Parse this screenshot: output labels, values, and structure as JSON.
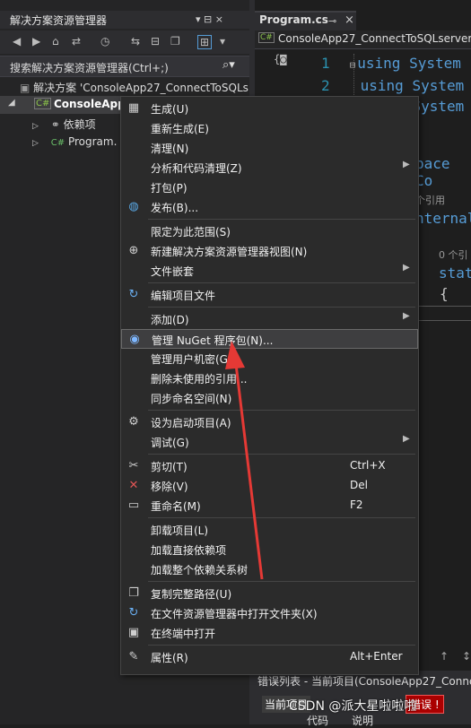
{
  "solution_explorer": {
    "title": "解决方案资源管理器",
    "pin_glyphs": "▾ ⊟ ×",
    "search_placeholder": "搜索解决方案资源管理器(Ctrl+;)",
    "tree": [
      {
        "label": "解决方案 'ConsoleApp27_ConnectToSQLs"
      },
      {
        "label": "ConsoleApp"
      },
      {
        "label": "依赖项"
      },
      {
        "label": "Program."
      }
    ]
  },
  "editor": {
    "tab_label": "Program.cs",
    "nav_label": "ConsoleApp27_ConnectToSQLserver",
    "lines": [
      {
        "num": "1",
        "text": "using System"
      },
      {
        "num": "2",
        "text": "using System"
      },
      {
        "num": "3",
        "text": "using System"
      }
    ],
    "fragments": {
      "namespace": "pace Co",
      "ref1": "个引用",
      "internal": "nternal",
      "ref2": "0 个引",
      "stat": "stat",
      "brace": "{"
    },
    "error_list": "错误列表 - 当前项目(ConsoleApp27_Conne",
    "current_project": "当前项目",
    "watermark": "CSDN @派大星啦啦啦",
    "code_col": "代码",
    "desc_col": "说明"
  },
  "context_menu": {
    "items": [
      {
        "label": "生成(U)",
        "icon": "build-icon"
      },
      {
        "label": "重新生成(E)"
      },
      {
        "label": "清理(N)"
      },
      {
        "label": "分析和代码清理(Z)",
        "submenu": true
      },
      {
        "label": "打包(P)"
      },
      {
        "label": "发布(B)...",
        "icon": "globe-icon"
      },
      {
        "sep": true
      },
      {
        "label": "限定为此范围(S)"
      },
      {
        "label": "新建解决方案资源管理器视图(N)",
        "icon": "new-view-icon"
      },
      {
        "label": "文件嵌套",
        "submenu": true
      },
      {
        "sep": true
      },
      {
        "label": "编辑项目文件",
        "icon": "edit-project-icon"
      },
      {
        "sep": true
      },
      {
        "label": "添加(D)",
        "submenu": true
      },
      {
        "label": "管理 NuGet 程序包(N)...",
        "icon": "nuget-icon",
        "highlight": true
      },
      {
        "label": "管理用户机密(G)"
      },
      {
        "label": "删除未使用的引用..."
      },
      {
        "label": "同步命名空间(N)"
      },
      {
        "sep": true
      },
      {
        "label": "设为启动项目(A)",
        "icon": "gear-icon"
      },
      {
        "label": "调试(G)",
        "submenu": true
      },
      {
        "sep": true
      },
      {
        "label": "剪切(T)",
        "shortcut": "Ctrl+X",
        "icon": "scissors-icon"
      },
      {
        "label": "移除(V)",
        "shortcut": "Del",
        "icon": "remove-icon"
      },
      {
        "label": "重命名(M)",
        "shortcut": "F2",
        "icon": "rename-icon"
      },
      {
        "sep": true
      },
      {
        "label": "卸载项目(L)"
      },
      {
        "label": "加载直接依赖项"
      },
      {
        "label": "加载整个依赖关系树"
      },
      {
        "sep": true
      },
      {
        "label": "复制完整路径(U)",
        "icon": "copy-icon"
      },
      {
        "label": "在文件资源管理器中打开文件夹(X)",
        "icon": "refresh-icon"
      },
      {
        "label": "在终端中打开",
        "icon": "terminal-icon"
      },
      {
        "sep": true
      },
      {
        "label": "属性(R)",
        "shortcut": "Alt+Enter",
        "icon": "wrench-icon"
      }
    ]
  },
  "colors": {
    "accent": "#569cd6",
    "arrow": "#e53935"
  }
}
